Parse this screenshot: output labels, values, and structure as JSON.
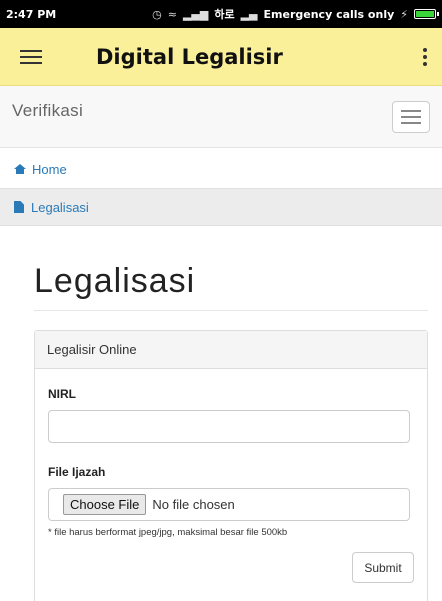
{
  "statusbar": {
    "time": "2:47 PM",
    "signal_text": "하로",
    "carrier": "Emergency calls only"
  },
  "appbar": {
    "title": "Digital Legalisir"
  },
  "navbar": {
    "brand": "Verifikasi",
    "items": [
      {
        "label": "Home",
        "icon": "home-icon"
      },
      {
        "label": "Legalisasi",
        "icon": "file-icon"
      }
    ]
  },
  "page": {
    "heading": "Legalisasi"
  },
  "form": {
    "panel_title": "Legalisir Online",
    "nirl_label": "NIRL",
    "nirl_value": "",
    "file_label": "File Ijazah",
    "choose_file": "Choose File",
    "no_file": "No file chosen",
    "help": "* file harus berformat jpeg/jpg, maksimal besar file 500kb",
    "submit": "Submit"
  },
  "colors": {
    "appbar": "#fbf09a",
    "link": "#2a7ab8",
    "battery": "#3ad43a"
  }
}
